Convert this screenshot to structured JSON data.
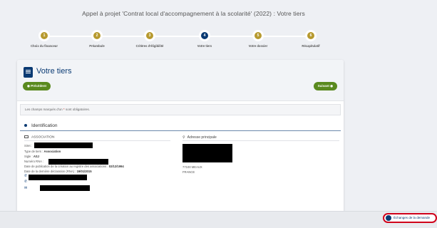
{
  "page_title": "Appel à projet 'Contrat local d'accompagnement à la scolarité' (2022) : Votre tiers",
  "stepper": [
    {
      "num": "1",
      "label": "Choix du financeur",
      "active": false
    },
    {
      "num": "2",
      "label": "Préambule",
      "active": false
    },
    {
      "num": "3",
      "label": "Critères d'éligibilité",
      "active": false
    },
    {
      "num": "4",
      "label": "Votre tiers",
      "active": true
    },
    {
      "num": "5",
      "label": "Votre dossier",
      "active": false
    },
    {
      "num": "6",
      "label": "Récapitulatif",
      "active": false
    }
  ],
  "panel": {
    "title": "Votre tiers",
    "prev_label": "◉ Précédent",
    "next_label": "Suivant ◉",
    "required_note_pre": "Les champs marqués d'un",
    "required_star": "*",
    "required_note_post": "sont obligatoires."
  },
  "identification": {
    "section_title": "Identification",
    "assoc_title": "ASSOCIATION",
    "siret_label": "Siret :",
    "type_label": "Type de tiers :",
    "type_value": "Association",
    "sigle_label": "Sigle :",
    "sigle_value": "ASJ",
    "rna_label": "Numéro RNA :",
    "publication_label": "Date de publication de la création au registre des associations :",
    "publication_value": "02/12/1994",
    "declaration_label": "Date de la dernière déclaration (RNA) :",
    "declaration_value": "19/01/2015"
  },
  "address": {
    "title": "Adresse principale",
    "city": "77100 MEAUX",
    "country": "FRANCE"
  },
  "footer": {
    "exchange_label": "Échanges de la demande"
  },
  "colors": {
    "primary": "#0a3a73",
    "step_done": "#b79a2f",
    "button_green": "#5a8a1f",
    "highlight_red": "#d0021b"
  }
}
